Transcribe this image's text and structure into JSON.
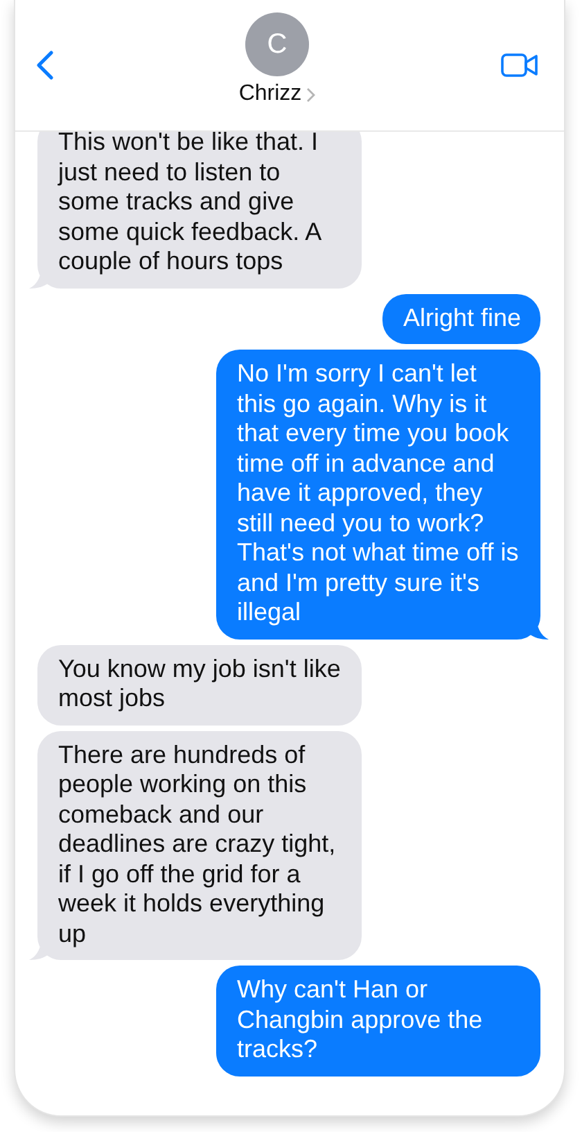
{
  "contact": {
    "initial": "C",
    "name": "Chrizz"
  },
  "messages": [
    {
      "kind": "received",
      "text": "This won't be like that. I just need to listen to some tracks and give some quick feedback. A couple of hours tops",
      "tail": true
    },
    {
      "kind": "sent",
      "text": "Alright fine",
      "tail": false
    },
    {
      "kind": "sent",
      "text": "No I'm sorry I can't let this go again. Why is it that every time you book time off in advance and have it approved, they still need you to work? That's not what time off is and I'm pretty sure it's illegal",
      "tail": true
    },
    {
      "kind": "received",
      "text": "You know my job isn't like most jobs",
      "tail": false
    },
    {
      "kind": "received",
      "text": "There are hundreds of people working on this comeback and our deadlines are crazy tight, if I go off the grid for a week it holds everything up",
      "tail": true
    },
    {
      "kind": "sent",
      "text": "Why can't Han or Changbin approve the tracks?",
      "tail": false
    }
  ]
}
